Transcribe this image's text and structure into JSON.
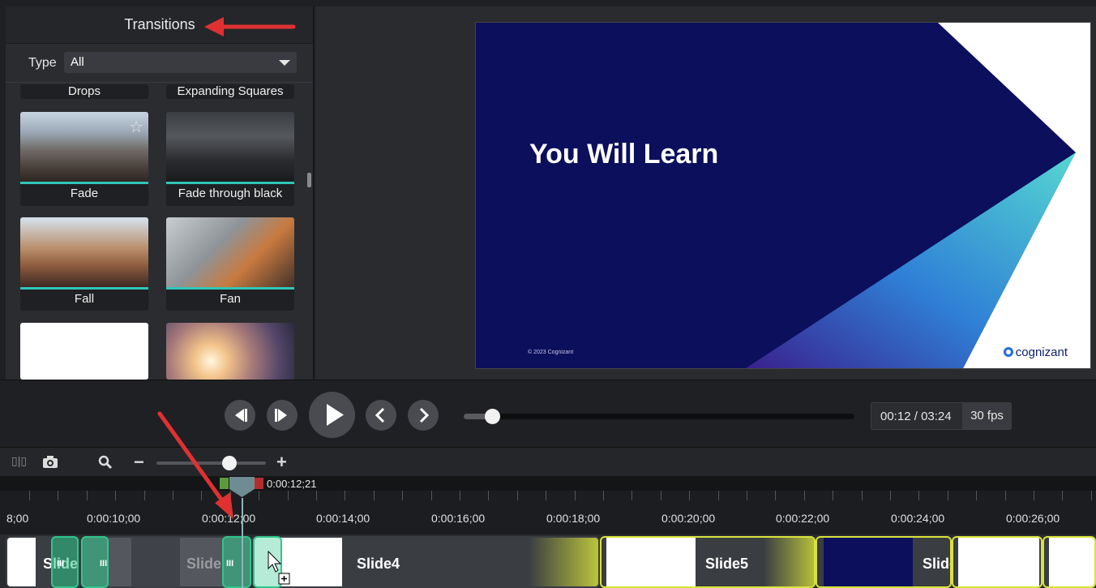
{
  "panel": {
    "title": "Transitions",
    "type_label": "Type",
    "type_value": "All",
    "tiles": [
      {
        "label": "Drops"
      },
      {
        "label": "Expanding Squares"
      },
      {
        "label": "Fade"
      },
      {
        "label": "Fade through black"
      },
      {
        "label": "Fall"
      },
      {
        "label": "Fan"
      },
      {
        "label": ""
      },
      {
        "label": ""
      }
    ]
  },
  "preview": {
    "title": "You Will Learn",
    "copyright": "© 2023 Cognizant",
    "logo": "cognizant"
  },
  "player": {
    "current_time": "00:12",
    "total_time": "03:24",
    "time_sep": " / ",
    "fps": "30 fps",
    "progress": 0.06
  },
  "timeline": {
    "playhead_time": "0:00:12;21",
    "ticks": [
      "8;00",
      "0:00:10;00",
      "0:00:12;00",
      "0:00:14;00",
      "0:00:16;00",
      "0:00:18;00",
      "0:00:20;00",
      "0:00:22;00",
      "0:00:24;00",
      "0:00:26;00"
    ],
    "clips": [
      "Slide",
      "Slide",
      "Slide4",
      "Slide5",
      "Slide"
    ],
    "zoom_minus": "−",
    "zoom_plus": "+"
  },
  "colors": {
    "accent": "#2fc6b9",
    "clip_border": "#d8e33a",
    "slide_bg": "#0b0f5c",
    "annotation": "#e03131"
  }
}
